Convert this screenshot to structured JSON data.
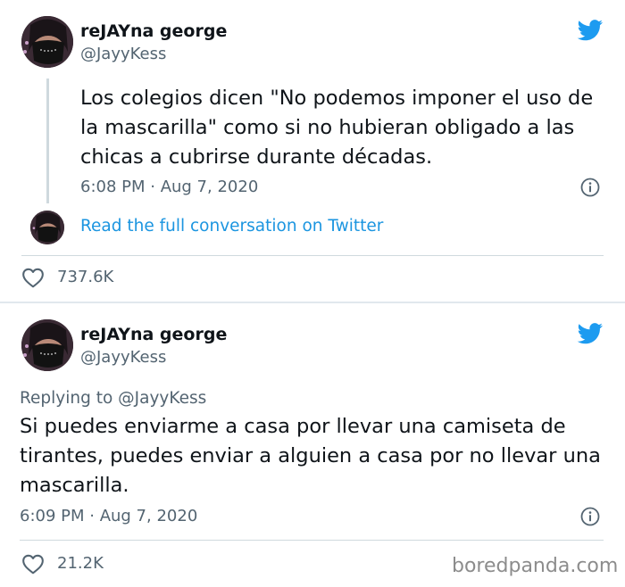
{
  "colors": {
    "twitter_blue": "#1d9bf0",
    "link_blue": "#1b95e0",
    "muted_text": "#536471",
    "card_background": "#ffffff",
    "separator": "#e1e8ed"
  },
  "tweets": [
    {
      "display_name": "reJAYna george",
      "handle": "@JayyKess",
      "text": "Los colegios dicen \"No podemos imponer el uso de la mascarilla\" como si no hubieran obligado a las chicas a cubrirse durante décadas.",
      "timestamp": "6:08 PM · Aug 7, 2020",
      "thread_link": "Read the full conversation on Twitter",
      "likes": "737.6K",
      "icons": [
        "avatar",
        "twitter-bird-icon",
        "info-icon",
        "heart-icon"
      ]
    },
    {
      "display_name": "reJAYna george",
      "handle": "@JayyKess",
      "replying_to": "Replying to @JayyKess",
      "text": "Si puedes enviarme a casa por llevar una camiseta de tirantes, puedes enviar a alguien a casa por no llevar una mascarilla.",
      "timestamp": "6:09 PM · Aug 7, 2020",
      "likes": "21.2K",
      "icons": [
        "avatar",
        "twitter-bird-icon",
        "info-icon",
        "heart-icon"
      ]
    }
  ],
  "watermark": "boredpanda.com"
}
